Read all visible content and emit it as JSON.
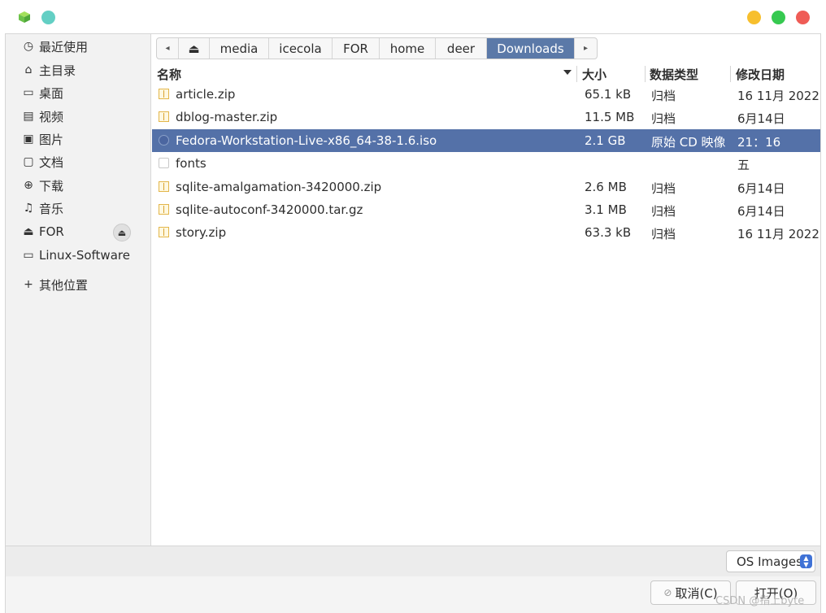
{
  "sidebar": {
    "items": [
      {
        "icon": "clock-icon",
        "glyph": "◷",
        "label": "最近使用"
      },
      {
        "icon": "home-icon",
        "glyph": "⌂",
        "label": "主目录"
      },
      {
        "icon": "desktop-icon",
        "glyph": "▭",
        "label": "桌面"
      },
      {
        "icon": "video-icon",
        "glyph": "▤",
        "label": "视频"
      },
      {
        "icon": "picture-icon",
        "glyph": "▣",
        "label": "图片"
      },
      {
        "icon": "document-icon",
        "glyph": "▢",
        "label": "文档"
      },
      {
        "icon": "download-icon",
        "glyph": "⊕",
        "label": "下载"
      },
      {
        "icon": "music-icon",
        "glyph": "♫",
        "label": "音乐"
      },
      {
        "icon": "drive-icon",
        "glyph": "⏏",
        "label": "FOR"
      },
      {
        "icon": "folder-icon",
        "glyph": "▭",
        "label": "Linux-Software"
      },
      {
        "icon": "plus-icon",
        "glyph": "+",
        "label": "其他位置"
      }
    ],
    "eject_glyph": "⏏"
  },
  "pathbar": {
    "back_glyph": "◂",
    "drive_glyph": "⏏",
    "segments": [
      "media",
      "icecola",
      "FOR",
      "home",
      "deer",
      "Downloads"
    ],
    "forward_glyph": "▸"
  },
  "columns": {
    "name": "名称",
    "size": "大小",
    "type": "数据类型",
    "modified": "修改日期"
  },
  "files": [
    {
      "name": "article.zip",
      "size": "65.1 kB",
      "type": "归档",
      "modified": "16 11月 2022",
      "icon": "archive-icon"
    },
    {
      "name": "dblog-master.zip",
      "size": "11.5 MB",
      "type": "归档",
      "modified": "6月14日",
      "icon": "archive-icon"
    },
    {
      "name": "Fedora-Workstation-Live-x86_64-38-1.6.iso",
      "size": "2.1 GB",
      "type": "原始 CD 映像",
      "modified": "21：16",
      "icon": "disc-image-icon"
    },
    {
      "name": "fonts",
      "size": "",
      "type": "",
      "modified": "五",
      "icon": "folder-icon"
    },
    {
      "name": "sqlite-amalgamation-3420000.zip",
      "size": "2.6 MB",
      "type": "归档",
      "modified": "6月14日",
      "icon": "archive-icon"
    },
    {
      "name": "sqlite-autoconf-3420000.tar.gz",
      "size": "3.1 MB",
      "type": "归档",
      "modified": "6月14日",
      "icon": "archive-icon"
    },
    {
      "name": "story.zip",
      "size": "63.3 kB",
      "type": "归档",
      "modified": "16 11月 2022",
      "icon": "archive-icon"
    }
  ],
  "selected_file": "Fedora-Workstation-Live-x86_64-38-1.6.iso",
  "filter": {
    "label": "OS Images"
  },
  "buttons": {
    "cancel": "取消(C)",
    "open": "打开(O)"
  },
  "watermark": "CSDN @指上byte",
  "colors": {
    "selection": "#5471a8",
    "active_crumb": "#5b79a8",
    "win_minimize": "#f7bf2d",
    "win_maximize": "#36c950",
    "win_close": "#ef5c56",
    "teal": "#63cfc4"
  }
}
